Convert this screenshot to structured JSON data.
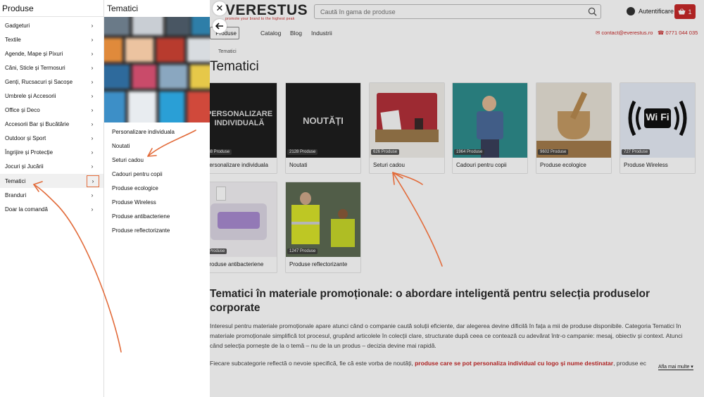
{
  "site": {
    "logo": "VERESTUS",
    "tagline": "promote your brand to the highest peak",
    "search_placeholder": "Caută în gama de produse",
    "auth_label": "Autentificare",
    "cart_count": "1"
  },
  "nav": {
    "produse": "Produse",
    "links": [
      "Catalog",
      "Blog",
      "Industrii"
    ],
    "email": "contact@everestus.ro",
    "phone": "0771 044 035"
  },
  "breadcrumb": "Tematici",
  "page_title": "Tematici",
  "cards": [
    {
      "name": "Personalizare individuala",
      "count": "388 Produse",
      "overlay": "PERSONALIZARE INDIVIDUALĂ"
    },
    {
      "name": "Noutati",
      "count": "2128 Produse",
      "overlay": "NOUTĂȚI"
    },
    {
      "name": "Seturi cadou",
      "count": "626 Produse"
    },
    {
      "name": "Cadouri pentru copii",
      "count": "1964 Produse"
    },
    {
      "name": "Produse ecologice",
      "count": "9602 Produse"
    },
    {
      "name": "Produse Wireless",
      "count": "727 Produse",
      "overlay": "Wi Fi"
    },
    {
      "name": "Produse antibacteriene",
      "count": "1 Produse"
    },
    {
      "name": "Produse reflectorizante",
      "count": "1247 Produse"
    }
  ],
  "section": {
    "title": "Tematici în materiale promoționale: o abordare inteligentă pentru selecția produselor corporate",
    "p1": "Interesul pentru materiale promoționale apare atunci când o companie caută soluții eficiente, dar alegerea devine dificilă în fața a mii de produse disponibile. Categoria Tematici în materiale promoționale simplifică tot procesul, grupând articolele în colecții clare, structurate după ceea ce contează cu adevărat într-o campanie: mesaj, obiectiv și context. Atunci când selecția pornește de la o temă – nu de la un produs – decizia devine mai rapidă.",
    "p2_start": "Fiecare subcategorie reflectă o nevoie specifică, fie că este vorba de noutăți,",
    "p2_link": "produse care se pot personaliza individual cu logo și nume destinatar",
    "p2_end": ", produse ecologice",
    "more": "Afla mai multe"
  },
  "menu": {
    "title": "Produse",
    "items": [
      "Gadgeturi",
      "Textile",
      "Agende, Mape și Pixuri",
      "Căni, Sticle și Termosuri",
      "Genți, Rucsacuri și Sacoșe",
      "Umbrele și Accesorii",
      "Office și Deco",
      "Accesorii Bar și Bucătărie",
      "Outdoor și Sport",
      "Îngrijire și Protecție",
      "Jocuri și Jucării",
      "Tematici",
      "Branduri",
      "Doar la comandă"
    ],
    "active_index": 11
  },
  "submenu": {
    "title": "Tematici",
    "items": [
      "Personalizare individuala",
      "Noutati",
      "Seturi cadou",
      "Cadouri pentru copii",
      "Produse ecologice",
      "Produse Wireless",
      "Produse antibacteriene",
      "Produse reflectorizante"
    ]
  },
  "colors": {
    "accent": "#c62828",
    "annotation": "#e26b3a"
  }
}
